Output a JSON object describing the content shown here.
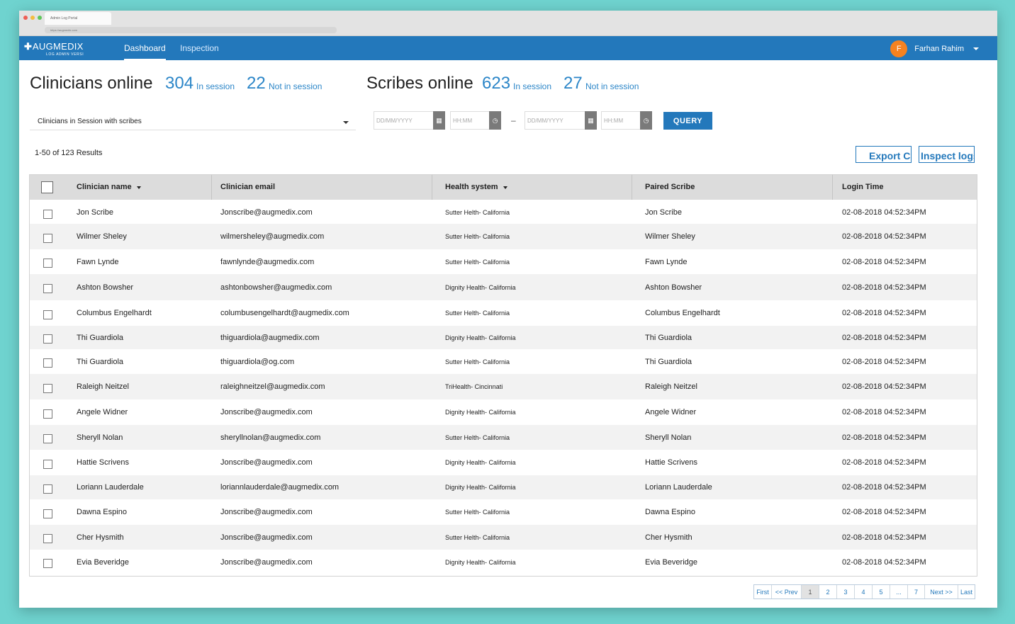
{
  "browser": {
    "tab_title": "Admin Log Portal",
    "url": "https://augmedix.com"
  },
  "nav": {
    "logo_text": "AUGMEDIX",
    "logo_sub": "LOG ADMIN   VERSI",
    "tabs": [
      {
        "label": "Dashboard",
        "active": true
      },
      {
        "label": "Inspection",
        "active": false
      }
    ],
    "user_initial": "F",
    "user_name": "Farhan Rahim"
  },
  "stats": {
    "clinicians_label": "Clinicians online",
    "clinicians_in": "304",
    "clinicians_in_label": "In session",
    "clinicians_out": "22",
    "clinicians_out_label": "Not in session",
    "scribes_label": "Scribes online",
    "scribes_in": "623",
    "scribes_in_label": "In session",
    "scribes_out": "27",
    "scribes_out_label": "Not in session"
  },
  "filters": {
    "selected": "Clinicians in Session with scribes",
    "date_placeholder": "DD/MM/YYYY",
    "time_placeholder": "HH:MM",
    "range_sep": "–",
    "query_label": "QUERY"
  },
  "results_text": "1-50 of 123 Results",
  "export_label": "Export CSV",
  "inspect_label": "Inspect logs",
  "columns": [
    "Clinician name",
    "Clinician email",
    "Health system",
    "Paired Scribe",
    "Login Time"
  ],
  "rows": [
    {
      "name": "Jon Scribe",
      "email": "Jonscribe@augmedix.com",
      "health": "Sutter Helth- California",
      "scribe": "Jon Scribe",
      "time": "02-08-2018 04:52:34PM"
    },
    {
      "name": "Wilmer Sheley",
      "email": "wilmersheley@augmedix.com",
      "health": "Sutter Helth- California",
      "scribe": "Wilmer Sheley",
      "time": "02-08-2018 04:52:34PM"
    },
    {
      "name": "Fawn Lynde",
      "email": "fawnlynde@augmedix.com",
      "health": "Sutter Helth- California",
      "scribe": "Fawn Lynde",
      "time": "02-08-2018 04:52:34PM"
    },
    {
      "name": "Ashton Bowsher",
      "email": "ashtonbowsher@augmedix.com",
      "health": "Dignity Health- California",
      "scribe": "Ashton Bowsher",
      "time": "02-08-2018 04:52:34PM"
    },
    {
      "name": "Columbus Engelhardt",
      "email": "columbusengelhardt@augmedix.com",
      "health": "Sutter Helth- California",
      "scribe": "Columbus Engelhardt",
      "time": "02-08-2018 04:52:34PM"
    },
    {
      "name": "Thi Guardiola",
      "email": "thiguardiola@augmedix.com",
      "health": "Dignity Health- California",
      "scribe": "Thi Guardiola",
      "time": "02-08-2018 04:52:34PM"
    },
    {
      "name": "Thi Guardiola",
      "email": "thiguardiola@og.com",
      "health": "Sutter Helth- California",
      "scribe": "Thi Guardiola",
      "time": "02-08-2018 04:52:34PM"
    },
    {
      "name": "Raleigh Neitzel",
      "email": "raleighneitzel@augmedix.com",
      "health": "TriHealth- Cincinnati",
      "scribe": "Raleigh Neitzel",
      "time": "02-08-2018 04:52:34PM"
    },
    {
      "name": "Angele Widner",
      "email": "Jonscribe@augmedix.com",
      "health": "Dignity Health- California",
      "scribe": "Angele Widner",
      "time": "02-08-2018 04:52:34PM"
    },
    {
      "name": "Sheryll Nolan",
      "email": "sheryllnolan@augmedix.com",
      "health": "Sutter Helth- California",
      "scribe": "Sheryll Nolan",
      "time": "02-08-2018 04:52:34PM"
    },
    {
      "name": "Hattie Scrivens",
      "email": "Jonscribe@augmedix.com",
      "health": "Dignity Health- California",
      "scribe": "Hattie Scrivens",
      "time": "02-08-2018 04:52:34PM"
    },
    {
      "name": "Loriann Lauderdale",
      "email": "loriannlauderdale@augmedix.com",
      "health": "Dignity Health- California",
      "scribe": "Loriann Lauderdale",
      "time": "02-08-2018 04:52:34PM"
    },
    {
      "name": "Dawna Espino",
      "email": "Jonscribe@augmedix.com",
      "health": "Sutter Helth- California",
      "scribe": "Dawna Espino",
      "time": "02-08-2018 04:52:34PM"
    },
    {
      "name": "Cher Hysmith",
      "email": "Jonscribe@augmedix.com",
      "health": "Sutter Helth- California",
      "scribe": "Cher Hysmith",
      "time": "02-08-2018 04:52:34PM"
    },
    {
      "name": "Evia Beveridge",
      "email": "Jonscribe@augmedix.com",
      "health": "Dignity Health- California",
      "scribe": "Evia Beveridge",
      "time": "02-08-2018 04:52:34PM"
    }
  ],
  "pagination": {
    "first": "First",
    "prev": "<< Prev",
    "pages": [
      "1",
      "2",
      "3",
      "4",
      "5",
      "...",
      "7"
    ],
    "current": "1",
    "next": "Next >>",
    "last": "Last"
  },
  "colors": {
    "brand_blue": "#2378bb",
    "accent_blue": "#2c86c8",
    "avatar_orange": "#f58220"
  }
}
